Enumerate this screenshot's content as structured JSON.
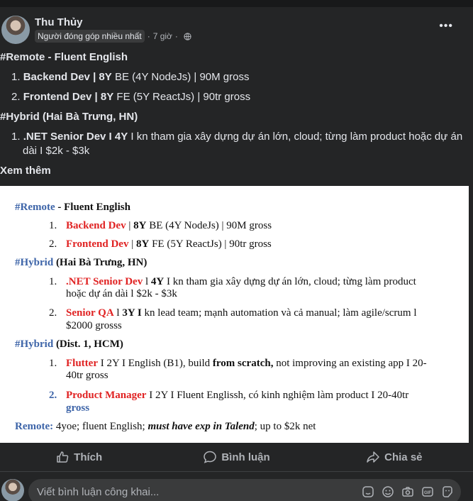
{
  "post": {
    "author": "Thu Thủy",
    "badge": "Người đóng góp nhiều nhất",
    "time": "7 giờ",
    "separator": "·",
    "more": "•••",
    "see_more": "Xem thêm"
  },
  "text_lines": {
    "l1": "#Remote - Fluent English",
    "l2a": "1. ",
    "l2b": "Backend Dev | 8Y",
    "l2c": " BE (4Y NodeJs) | 90M gross",
    "l3a": "2. ",
    "l3b": "Frontend Dev | 8Y",
    "l3c": " FE (5Y ReactJs) | 90tr gross",
    "l4": "#Hybrid (Hai Bà Trưng, HN)",
    "l5a": "1. ",
    "l5b": ".NET Senior Dev I 4Y",
    "l5c": " I kn tham gia xây dựng dự án lớn, cloud; từng làm product hoặc dự án",
    "l6": "dài I $2k - $3k"
  },
  "image": {
    "h1_tag": "#Remote",
    "h1_rest": " - Fluent English",
    "i1_num": "1.",
    "i1_role": "Backend Dev",
    "i1_mid": " | ",
    "i1_y": "8Y",
    "i1_rest": " BE (4Y NodeJs) | 90M gross",
    "i2_num": "2.",
    "i2_role": "Frontend Dev",
    "i2_mid": " | ",
    "i2_y": "8Y",
    "i2_rest": " FE (5Y ReactJs) | 90tr gross",
    "h2_tag": "#Hybrid",
    "h2_rest": " (Hai Bà Trưng, HN)",
    "i3_num": "1.",
    "i3_role": ".NET Senior Dev",
    "i3_mid": " l ",
    "i3_y": "4Y",
    "i3_rest": " I kn tham gia xây dựng dự án lớn, cloud; từng làm product",
    "i3_line2": "hoặc dự án dài l $2k - $3k",
    "i4_num": "2.",
    "i4_role": "Senior QA",
    "i4_mid": " l ",
    "i4_y": "3Y I",
    "i4_rest": " kn lead team; mạnh automation và cả manual; làm agile/scrum l",
    "i4_line2": "$2000 grosss",
    "h3_tag": "#Hybrid",
    "h3_rest": " (Dist. 1, HCM)",
    "i5_num": "1.",
    "i5_role": "Flutter",
    "i5_rest1": " I 2Y I English (B1), build ",
    "i5_bold": "from scratch,",
    "i5_rest2": " not improving an existing app I 20-",
    "i5_line2": "40tr gross",
    "i6_num": "2.",
    "i6_role": "Product Manager",
    "i6_rest": " I 2Y I Fluent Englissh, có kinh nghiệm làm product I 20-40tr",
    "i6_line2": "gross",
    "f_tag": "Remote:",
    "f_rest1": " 4yoe; fluent English; ",
    "f_bi": "must have exp in Talend",
    "f_rest2": "; up to $2k net"
  },
  "actions": {
    "like": "Thích",
    "comment": "Bình luận",
    "share": "Chia sẻ"
  },
  "comment_box": {
    "placeholder": "Viết bình luận công khai..."
  },
  "icons": {
    "globe": "globe-icon",
    "like": "thumbs-up-icon",
    "comment": "speech-bubble-icon",
    "share": "share-arrow-icon",
    "sticker": "sticker-icon",
    "emoji": "emoji-icon",
    "camera": "camera-icon",
    "gif": "gif-icon",
    "avatar_sticker": "avatar-sticker-icon"
  }
}
